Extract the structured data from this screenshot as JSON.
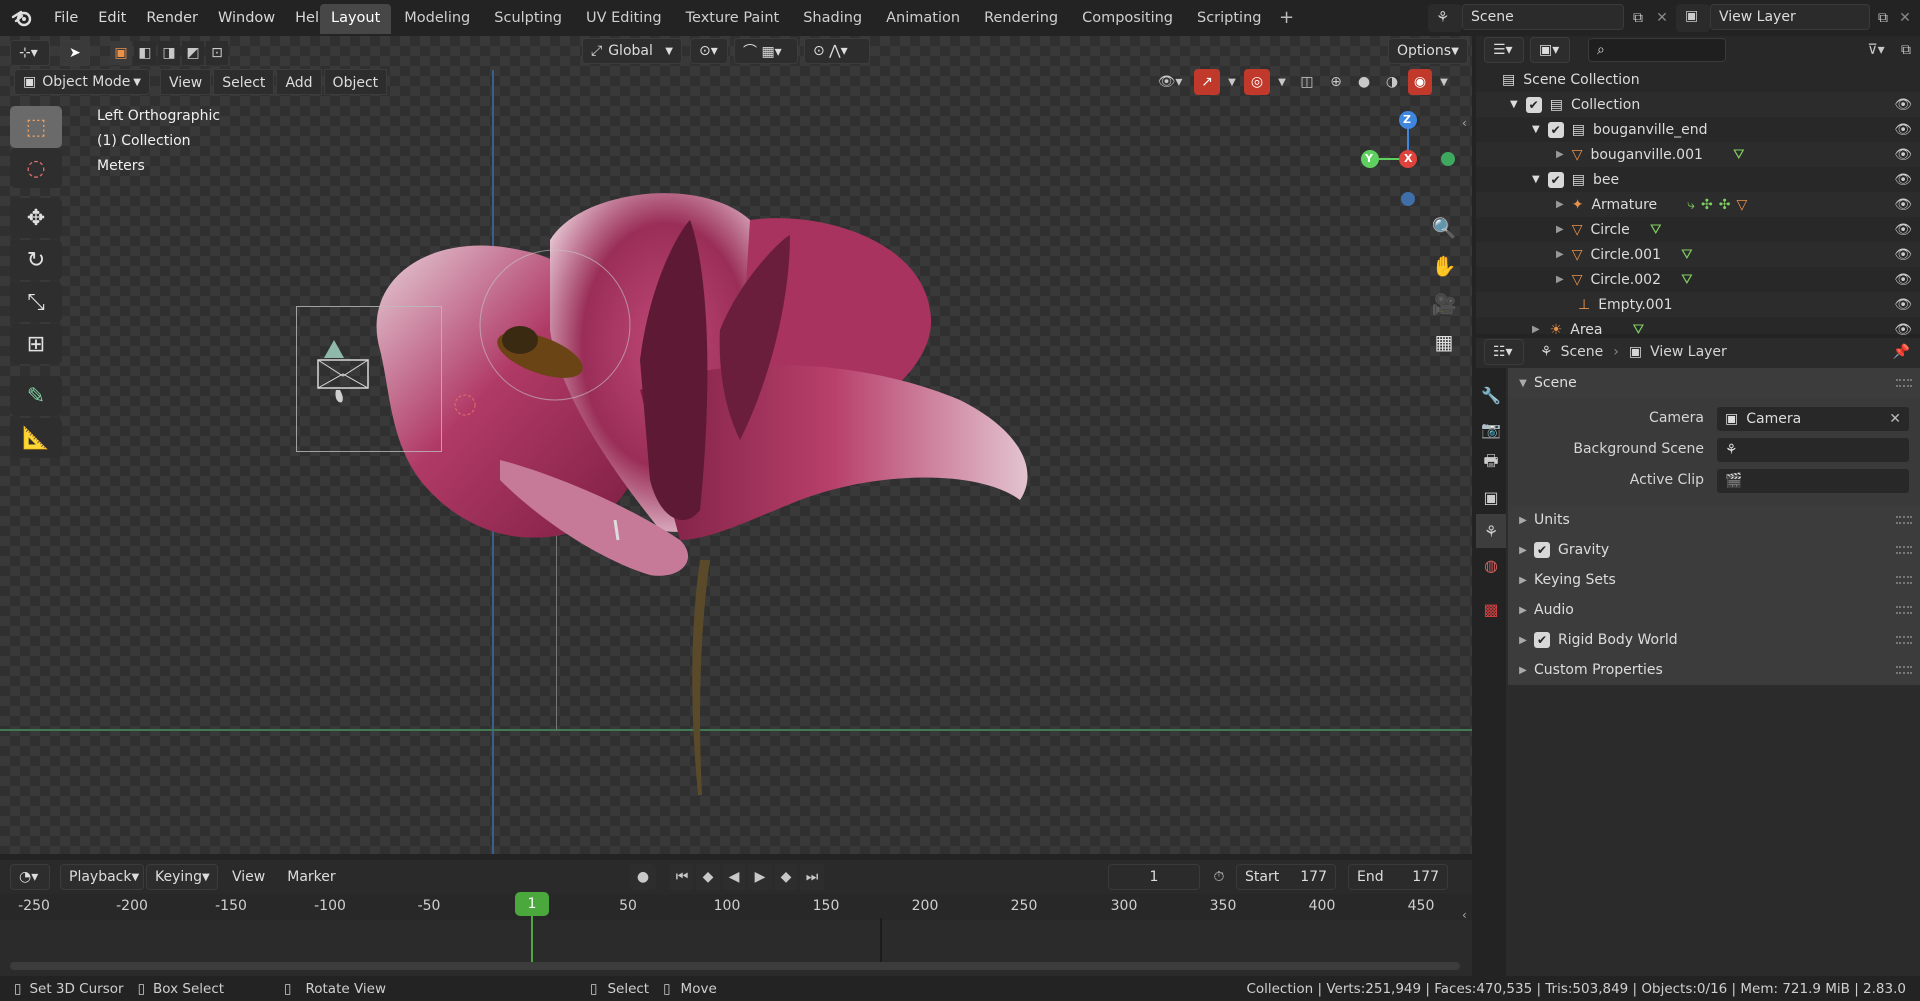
{
  "menu": {
    "items": [
      "File",
      "Edit",
      "Render",
      "Window",
      "Help"
    ]
  },
  "workspaces": {
    "tabs": [
      "Layout",
      "Modeling",
      "Sculpting",
      "UV Editing",
      "Texture Paint",
      "Shading",
      "Animation",
      "Rendering",
      "Compositing",
      "Scripting"
    ],
    "active": "Layout"
  },
  "scene_selector": {
    "value": "Scene"
  },
  "view_layer_selector": {
    "value": "View Layer"
  },
  "toolbar": {
    "orientation": "Global",
    "options_label": "Options"
  },
  "viewport_header": {
    "mode": "Object Mode",
    "menus": [
      "View",
      "Select",
      "Add",
      "Object"
    ]
  },
  "viewport_overlay": {
    "view_name": "Left Orthographic",
    "collection": "(1) Collection",
    "units": "Meters"
  },
  "gizmo": {
    "z": "Z",
    "y": "Y",
    "x": "X"
  },
  "timeline": {
    "menus": [
      "Playback",
      "Keying",
      "View",
      "Marker"
    ],
    "current_frame": "1",
    "start_label": "Start",
    "start": "177",
    "end_label": "End",
    "end": "177",
    "ruler_ticks": [
      "-250",
      "-200",
      "-150",
      "-100",
      "-50",
      "1",
      "50",
      "100",
      "150",
      "200",
      "250",
      "300",
      "350",
      "400",
      "450"
    ]
  },
  "status": {
    "hints": [
      "Set 3D Cursor",
      "Box Select",
      "Rotate View",
      "Select",
      "Move"
    ],
    "stats": "Collection | Verts:251,949 | Faces:470,535 | Tris:503,849 | Objects:0/16 | Mem: 721.9 MiB | 2.83.0"
  },
  "outliner": {
    "rows": [
      {
        "label": "Scene Collection"
      },
      {
        "label": "Collection"
      },
      {
        "label": "bouganville_end"
      },
      {
        "label": "bouganville.001"
      },
      {
        "label": "bee"
      },
      {
        "label": "Armature"
      },
      {
        "label": "Circle"
      },
      {
        "label": "Circle.001"
      },
      {
        "label": "Circle.002"
      },
      {
        "label": "Empty.001"
      },
      {
        "label": "Area"
      }
    ]
  },
  "properties": {
    "breadcrumb": {
      "scene": "Scene",
      "view_layer": "View Layer"
    },
    "scene_panel": {
      "title": "Scene",
      "camera_label": "Camera",
      "camera_value": "Camera",
      "background_scene_label": "Background Scene",
      "active_clip_label": "Active Clip"
    },
    "subpanels": [
      "Units",
      "Gravity",
      "Keying Sets",
      "Audio",
      "Rigid Body World",
      "Custom Properties"
    ]
  },
  "colors": {
    "accent_orange": "#e8914a",
    "frame_green": "#4aa83c",
    "axis_x": "#e0433c",
    "axis_y": "#5fcf5f",
    "axis_z": "#3f86de"
  }
}
